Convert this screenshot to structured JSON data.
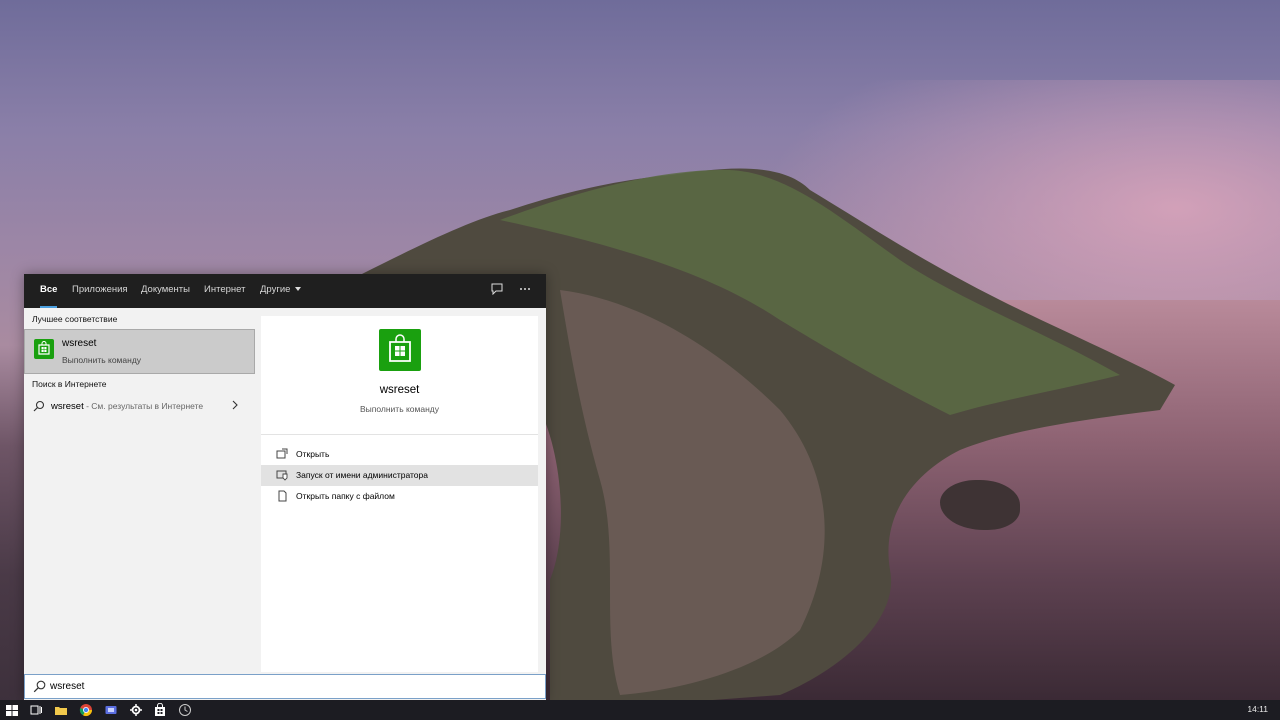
{
  "search": {
    "tabs": [
      {
        "label": "Все",
        "active": true
      },
      {
        "label": "Приложения",
        "active": false
      },
      {
        "label": "Документы",
        "active": false
      },
      {
        "label": "Интернет",
        "active": false
      },
      {
        "label": "Другие",
        "active": false
      }
    ],
    "query": "wsreset"
  },
  "best_match": {
    "section_title": "Лучшее соответствие",
    "title": "wsreset",
    "subtitle": "Выполнить команду"
  },
  "web": {
    "section_title": "Поиск в Интернете",
    "query": "wsreset",
    "hint": " - См. результаты в Интернете"
  },
  "detail": {
    "title": "wsreset",
    "subtitle": "Выполнить команду",
    "actions": [
      {
        "label": "Открыть"
      },
      {
        "label": "Запуск от имени администратора"
      },
      {
        "label": "Открыть папку с файлом"
      }
    ]
  },
  "taskbar": {
    "clock": "14:11"
  },
  "colors": {
    "accent": "#1aa00f",
    "tab_underline": "#4a9fdf",
    "topbar": "#1f1f1f"
  }
}
